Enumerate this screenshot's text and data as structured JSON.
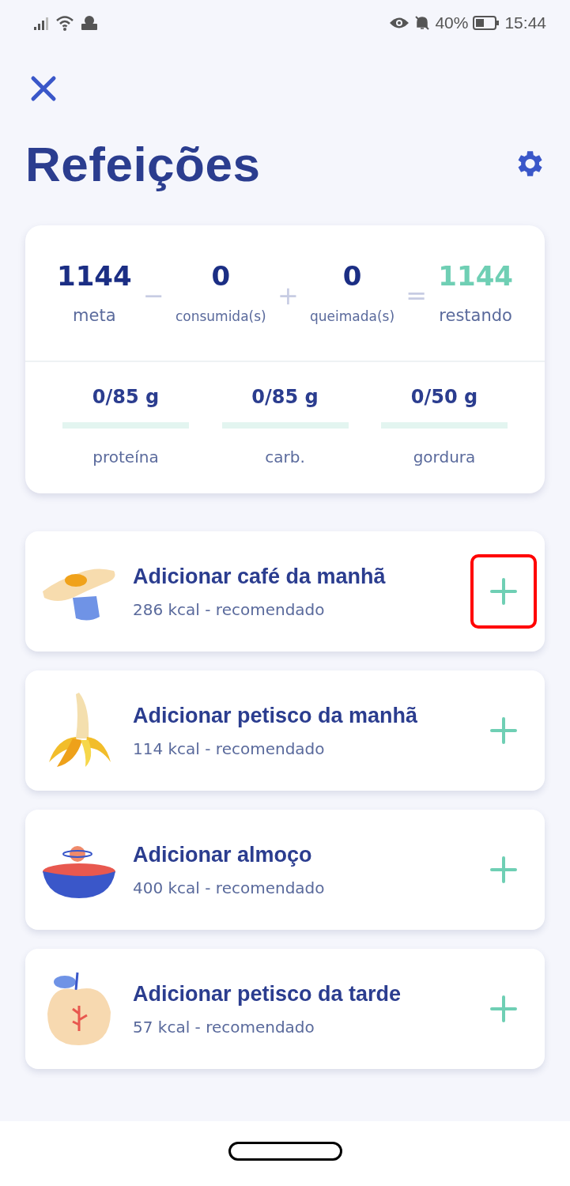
{
  "status_bar": {
    "battery_text": "40%",
    "time": "15:44"
  },
  "title": "Refeições",
  "summary": {
    "items": [
      {
        "value": "1144",
        "label": "meta",
        "kind": "goal"
      },
      {
        "value": "0",
        "label": "consumida(s)",
        "kind": "eaten"
      },
      {
        "value": "0",
        "label": "queimada(s)",
        "kind": "burned"
      },
      {
        "value": "1144",
        "label": "restando",
        "kind": "remaining"
      }
    ],
    "operators": [
      "−",
      "+",
      "="
    ],
    "macros": [
      {
        "value": "0/85 g",
        "label": "proteína",
        "level": 0
      },
      {
        "value": "0/85 g",
        "label": "carb.",
        "level": 0
      },
      {
        "value": "0/50 g",
        "label": "gordura",
        "level": 0
      }
    ]
  },
  "meals": [
    {
      "kind": "egg",
      "title": "Adicionar café da manhã",
      "subtitle": "286 kcal - recomendado",
      "highlighted": true
    },
    {
      "kind": "banana",
      "title": "Adicionar petisco da manhã",
      "subtitle": "114 kcal - recomendado",
      "highlighted": false
    },
    {
      "kind": "bowl",
      "title": "Adicionar almoço",
      "subtitle": "400 kcal - recomendado",
      "highlighted": false
    },
    {
      "kind": "apple",
      "title": "Adicionar petisco da tarde",
      "subtitle": "57 kcal - recomendado",
      "highlighted": false
    }
  ]
}
